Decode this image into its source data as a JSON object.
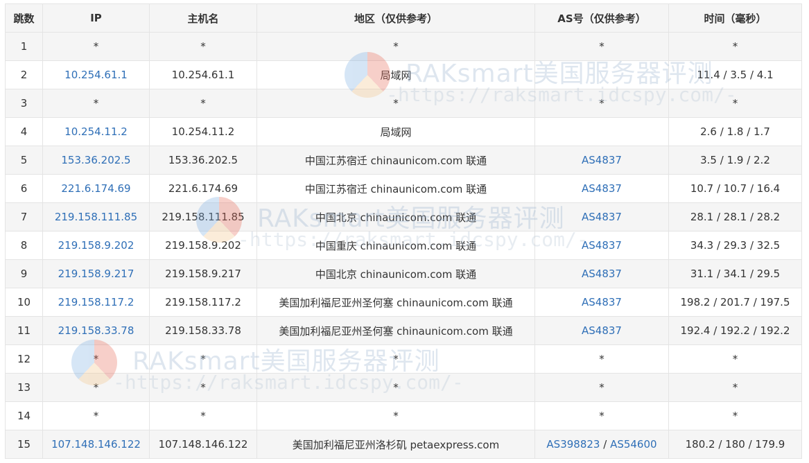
{
  "headers": [
    "跳数",
    "IP",
    "主机名",
    "地区（仅供参考）",
    "AS号（仅供参考）",
    "时间（毫秒）"
  ],
  "rows": [
    {
      "hop": "1",
      "ip": "*",
      "host": "*",
      "region": "*",
      "as": [
        "*"
      ],
      "time": "*"
    },
    {
      "hop": "2",
      "ip": "10.254.61.1",
      "host": "10.254.61.1",
      "region": "局域网",
      "as": [],
      "time": "11.4 / 3.5 / 4.1"
    },
    {
      "hop": "3",
      "ip": "*",
      "host": "*",
      "region": "*",
      "as": [
        "*"
      ],
      "time": "*"
    },
    {
      "hop": "4",
      "ip": "10.254.11.2",
      "host": "10.254.11.2",
      "region": "局域网",
      "as": [],
      "time": "2.6 / 1.8 / 1.7"
    },
    {
      "hop": "5",
      "ip": "153.36.202.5",
      "host": "153.36.202.5",
      "region": "中国江苏宿迁 chinaunicom.com 联通",
      "as": [
        "AS4837"
      ],
      "time": "3.5 / 1.9 / 2.2"
    },
    {
      "hop": "6",
      "ip": "221.6.174.69",
      "host": "221.6.174.69",
      "region": "中国江苏宿迁 chinaunicom.com 联通",
      "as": [
        "AS4837"
      ],
      "time": "10.7 / 10.7 / 16.4"
    },
    {
      "hop": "7",
      "ip": "219.158.111.85",
      "host": "219.158.111.85",
      "region": "中国北京 chinaunicom.com 联通",
      "as": [
        "AS4837"
      ],
      "time": "28.1 / 28.1 / 28.2"
    },
    {
      "hop": "8",
      "ip": "219.158.9.202",
      "host": "219.158.9.202",
      "region": "中国重庆 chinaunicom.com 联通",
      "as": [
        "AS4837"
      ],
      "time": "34.3 / 29.3 / 32.5"
    },
    {
      "hop": "9",
      "ip": "219.158.9.217",
      "host": "219.158.9.217",
      "region": "中国北京 chinaunicom.com 联通",
      "as": [
        "AS4837"
      ],
      "time": "31.1 / 34.1 / 29.5"
    },
    {
      "hop": "10",
      "ip": "219.158.117.2",
      "host": "219.158.117.2",
      "region": "美国加利福尼亚州圣何塞 chinaunicom.com 联通",
      "as": [
        "AS4837"
      ],
      "time": "198.2 / 201.7 / 197.5"
    },
    {
      "hop": "11",
      "ip": "219.158.33.78",
      "host": "219.158.33.78",
      "region": "美国加利福尼亚州圣何塞 chinaunicom.com 联通",
      "as": [
        "AS4837"
      ],
      "time": "192.4 / 192.2 / 192.2"
    },
    {
      "hop": "12",
      "ip": "*",
      "host": "*",
      "region": "*",
      "as": [
        "*"
      ],
      "time": "*"
    },
    {
      "hop": "13",
      "ip": "*",
      "host": "*",
      "region": "*",
      "as": [
        "*"
      ],
      "time": "*"
    },
    {
      "hop": "14",
      "ip": "*",
      "host": "*",
      "region": "*",
      "as": [
        "*"
      ],
      "time": "*"
    },
    {
      "hop": "15",
      "ip": "107.148.146.122",
      "host": "107.148.146.122",
      "region": "美国加利福尼亚州洛杉矶 petaexpress.com",
      "as": [
        "AS398823",
        "AS54600"
      ],
      "time": "180.2 / 180 / 179.9"
    }
  ],
  "watermark": {
    "title": "RAKsmart美国服务器评测",
    "subtitle": "-https://raksmart.idcspy.com/-"
  }
}
